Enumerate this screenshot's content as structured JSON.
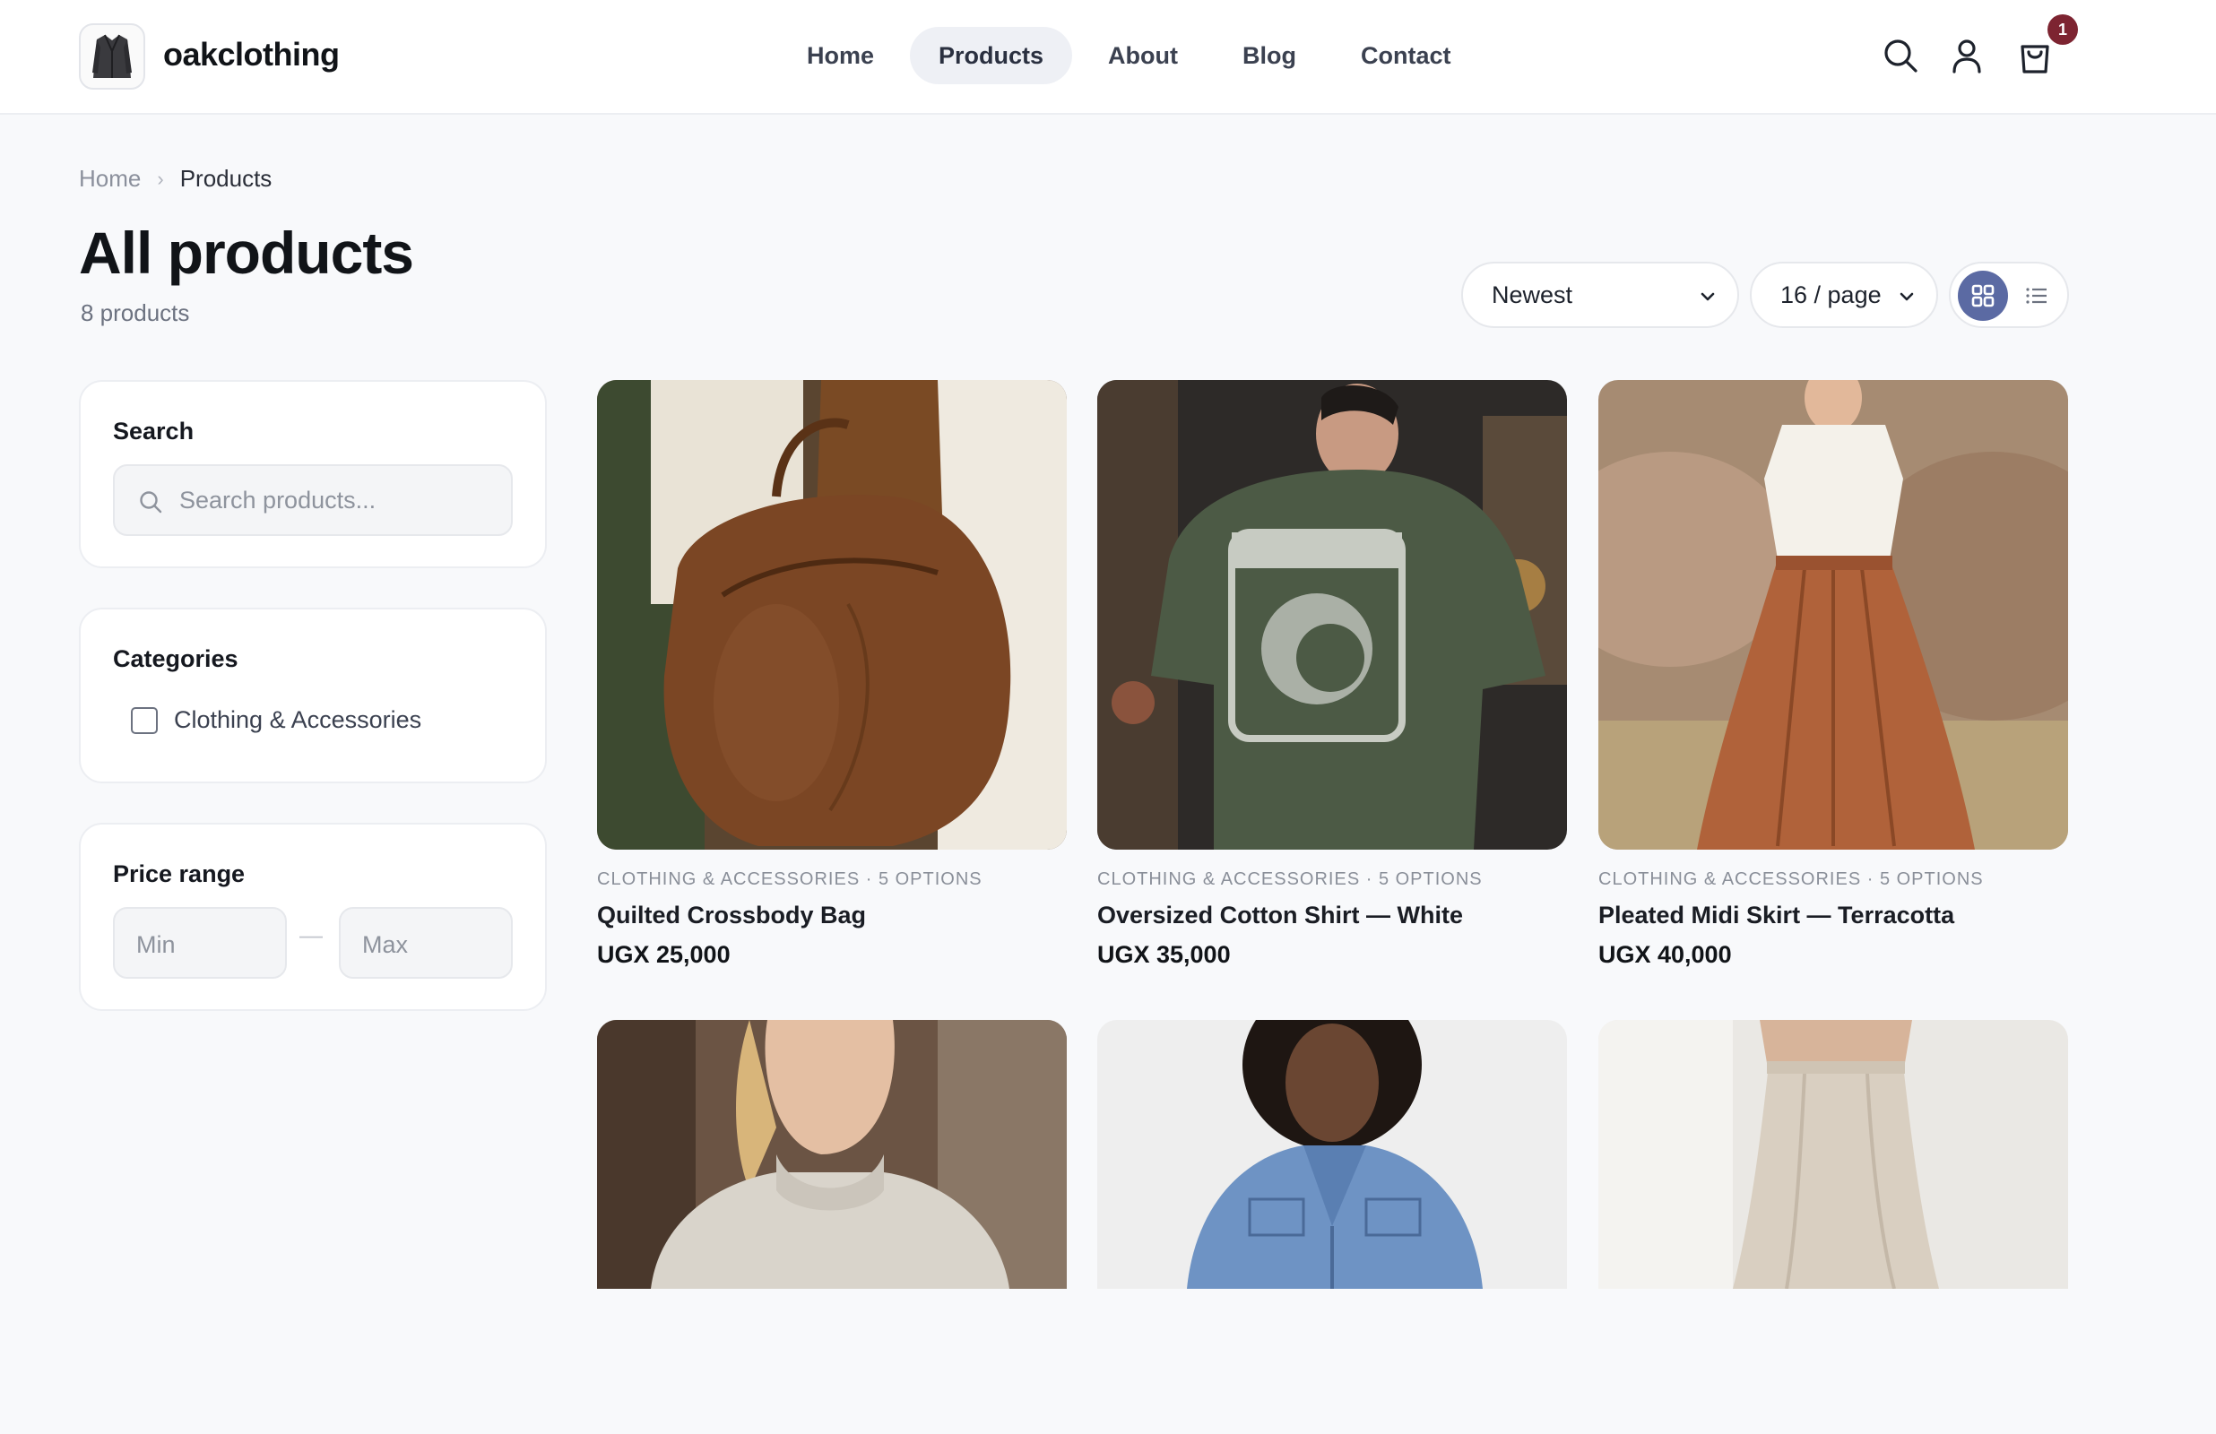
{
  "header": {
    "brand": "oakclothing",
    "nav": [
      "Home",
      "Products",
      "About",
      "Blog",
      "Contact"
    ],
    "active_nav": "Products",
    "cart_count": "1",
    "icons": [
      "search-icon",
      "user-icon",
      "cart-icon"
    ]
  },
  "breadcrumb": {
    "home": "Home",
    "current": "Products"
  },
  "page": {
    "title": "All products",
    "count": "8 products"
  },
  "toolbar": {
    "sort": "Newest",
    "per_page": "16 / page",
    "view_mode": "grid"
  },
  "sidebar": {
    "search": {
      "title": "Search",
      "placeholder": "Search products..."
    },
    "categories": {
      "title": "Categories",
      "items": [
        "Clothing & Accessories"
      ]
    },
    "price": {
      "title": "Price range",
      "min_placeholder": "Min",
      "max_placeholder": "Max",
      "separator": "—"
    }
  },
  "products": [
    {
      "meta": "CLOTHING & ACCESSORIES · 5 OPTIONS",
      "name": "Quilted Crossbody Bag",
      "price": "UGX 25,000"
    },
    {
      "meta": "CLOTHING & ACCESSORIES · 5 OPTIONS",
      "name": "Oversized Cotton Shirt — White",
      "price": "UGX 35,000"
    },
    {
      "meta": "CLOTHING & ACCESSORIES · 5 OPTIONS",
      "name": "Pleated Midi Skirt — Terracotta",
      "price": "UGX 40,000"
    },
    {
      "meta": "",
      "name": "",
      "price": ""
    },
    {
      "meta": "",
      "name": "",
      "price": ""
    },
    {
      "meta": "",
      "name": "",
      "price": ""
    }
  ],
  "colors": {
    "accent": "#5b6aa3",
    "badge": "#7d2431",
    "background": "#f8f9fb"
  }
}
